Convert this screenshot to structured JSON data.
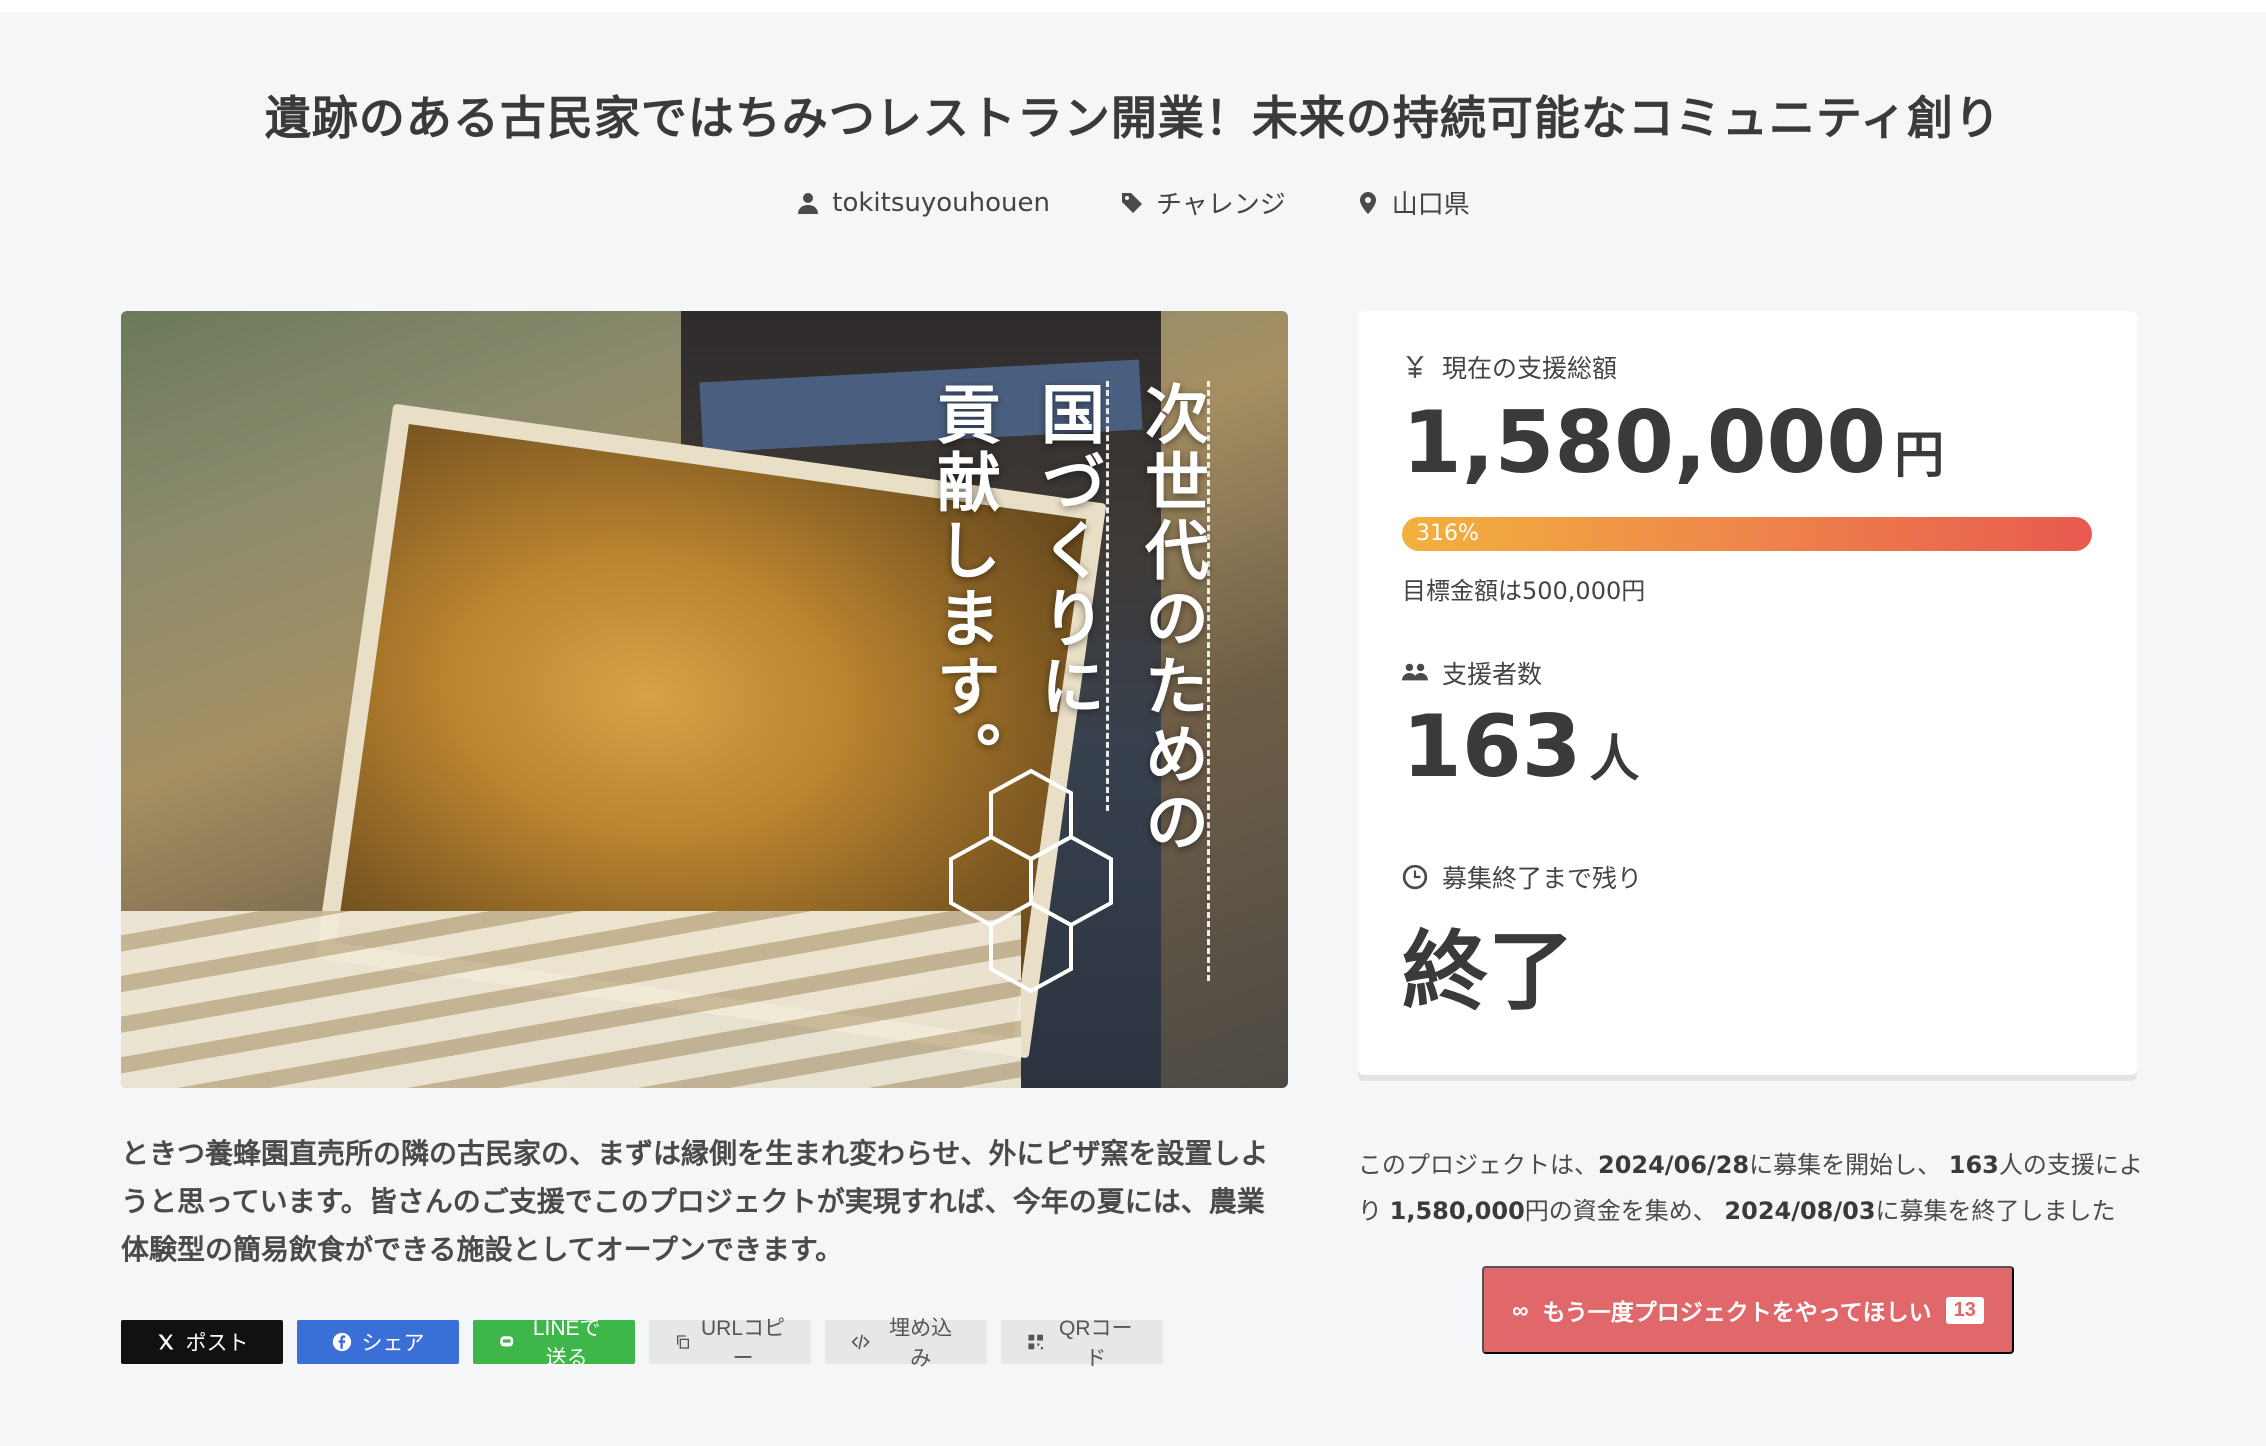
{
  "project": {
    "title": "遺跡のある古民家ではちみつレストラン開業！未来の持続可能なコミュニティ創り",
    "owner": "tokitsuyouhouen",
    "category": "チャレンジ",
    "location": "山口県"
  },
  "hero": {
    "vertical_text": [
      "次世代のための",
      "国づくりに",
      "貢献します。"
    ]
  },
  "stats": {
    "total_label": "現在の支援総額",
    "total_value": "1,580,000",
    "total_unit": "円",
    "progress_label": "316%",
    "progress_percent": 316,
    "goal_text": "目標金額は500,000円",
    "backers_label": "支援者数",
    "backers_value": "163",
    "backers_unit": "人",
    "remaining_label": "募集終了まで残り",
    "remaining_value": "終了"
  },
  "description": "ときつ養蜂園直売所の隣の古民家の、まずは縁側を生まれ変わらせ、外にピザ窯を設置しようと思っています。皆さんのご支援でこのプロジェクトが実現すれば、今年の夏には、農業体験型の簡易飲食ができる施設としてオープンできます。",
  "share": {
    "x": "ポスト",
    "facebook": "シェア",
    "line": "LINEで送る",
    "url": "URLコピー",
    "embed": "埋め込み",
    "qr": "QRコード"
  },
  "summary": {
    "p1": "このプロジェクトは、",
    "start_date": "2024/06/28",
    "p2": "に募集を開始し、",
    "backers": "163",
    "p3": "人の支援により",
    "amount": "1,580,000",
    "p4": "円の資金を集め、",
    "end_date": "2024/08/03",
    "p5": "に募集を終了しました"
  },
  "again_button": {
    "label": "もう一度プロジェクトをやってほしい",
    "count": "13"
  },
  "colors": {
    "accent": "#e0676a",
    "progress_start": "#f2b13c",
    "progress_end": "#e85a4f",
    "x": "#111111",
    "facebook": "#3b6fd8",
    "line": "#3fb64a"
  }
}
